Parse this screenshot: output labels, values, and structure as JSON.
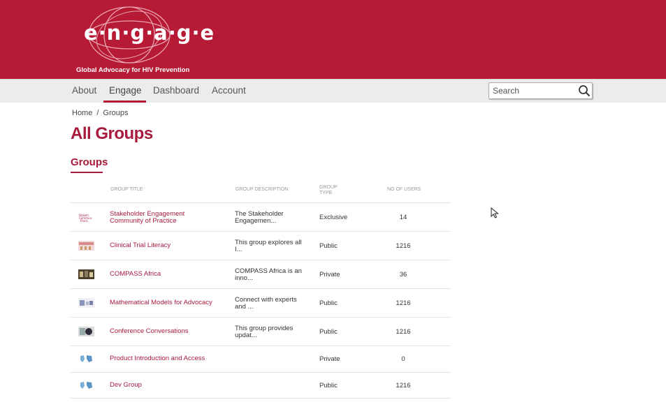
{
  "brand": {
    "logo_text": "e·n·g·a·g·e",
    "tagline": "Global Advocacy for HIV Prevention",
    "color": "#b71a35"
  },
  "nav": {
    "items": [
      {
        "label": "About"
      },
      {
        "label": "Engage",
        "active": true
      },
      {
        "label": "Dashboard"
      },
      {
        "label": "Account"
      }
    ]
  },
  "search": {
    "placeholder": "Search",
    "icon": "search-icon"
  },
  "breadcrumb": {
    "home": "Home",
    "separator": "/",
    "current": "Groups"
  },
  "page": {
    "title": "All Groups",
    "section": "Groups",
    "accent": "#a81b3c"
  },
  "table": {
    "headers": {
      "title": "GROUP TITLE",
      "description": "GROUP DESCRIPTION",
      "type_line1": "GROUP",
      "type_line2": "TYPE",
      "users": "NO OF USERS"
    },
    "rows": [
      {
        "title_1": "Stakeholder Engagement",
        "title_2": "Community of Practice",
        "desc_1": "The Stakeholder",
        "desc_2": "Engagemen...",
        "type": "Exclusive",
        "users": "14"
      },
      {
        "title_1": "Clinical Trial Literacy",
        "title_2": "",
        "desc_1": "This group explores all",
        "desc_2": "I...",
        "type": "Public",
        "users": "1216"
      },
      {
        "title_1": "COMPASS Africa",
        "title_2": "",
        "desc_1": "COMPASS Africa is an",
        "desc_2": "inno...",
        "type": "Private",
        "users": "36"
      },
      {
        "title_1": "Mathematical Models for Advocacy",
        "title_2": "",
        "desc_1": "Connect with experts",
        "desc_2": "and ...",
        "type": "Public",
        "users": "1216"
      },
      {
        "title_1": "Conference Conversations",
        "title_2": "",
        "desc_1": "This group provides",
        "desc_2": "updat...",
        "type": "Public",
        "users": "1216"
      },
      {
        "title_1": "Product Introduction and Access",
        "title_2": "",
        "desc_1": "",
        "desc_2": "",
        "type": "Private",
        "users": "0"
      },
      {
        "title_1": "Dev Group",
        "title_2": "",
        "desc_1": "",
        "desc_2": "",
        "type": "Public",
        "users": "1216"
      }
    ]
  }
}
